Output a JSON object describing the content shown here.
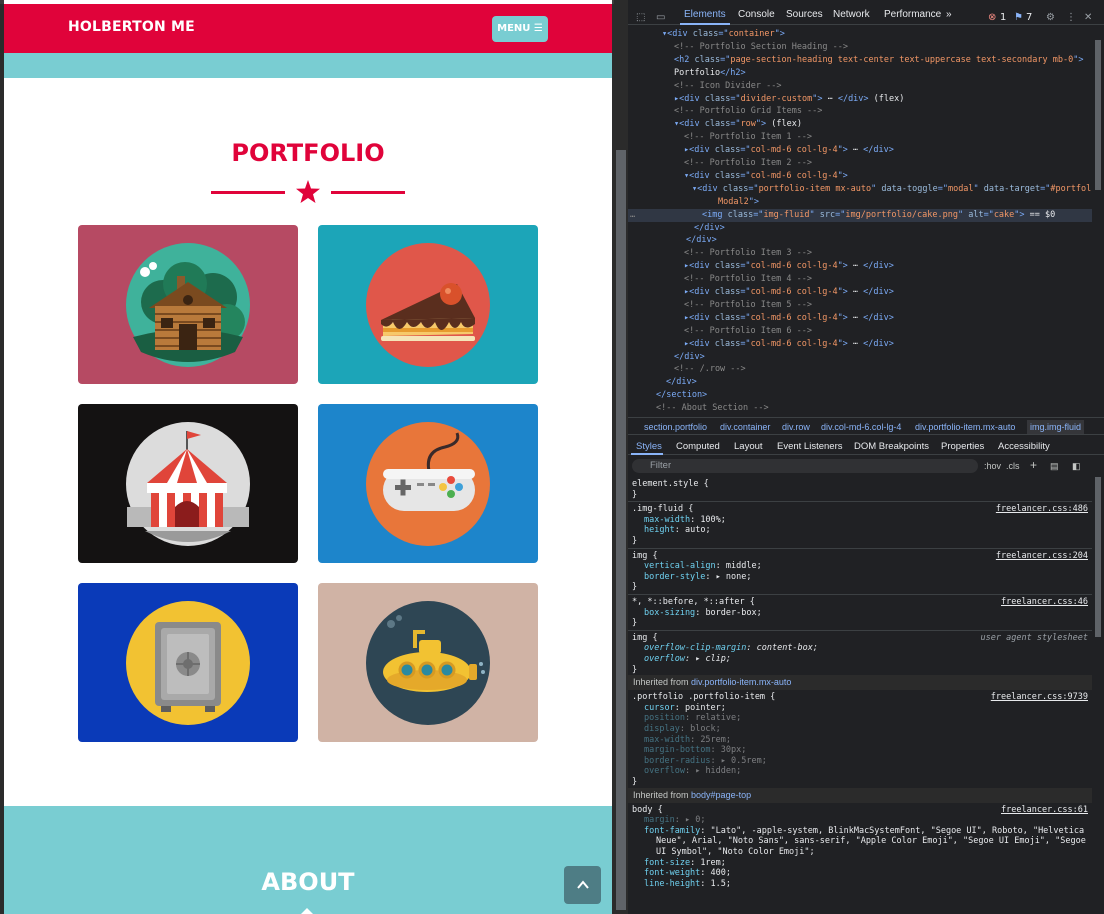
{
  "site": {
    "brand": "HOLBERTON ME",
    "menu_label": "MENU ☰",
    "portfolio_heading": "PORTFOLIO",
    "about_heading": "ABOUT",
    "portfolio_items": [
      {
        "alt": "cabin",
        "bg": "#b64a63"
      },
      {
        "alt": "cake",
        "bg": "#1ca5b8"
      },
      {
        "alt": "circus",
        "bg": "#141212"
      },
      {
        "alt": "game",
        "bg": "#1d85cb"
      },
      {
        "alt": "safe",
        "bg": "#0a3ab8"
      },
      {
        "alt": "submarine",
        "bg": "#d0b3a5"
      }
    ],
    "scroll_top_icon": "chevron-up-icon"
  },
  "devtools": {
    "tabs": [
      "Elements",
      "Console",
      "Sources",
      "Network",
      "Performance",
      "»"
    ],
    "errors": "1",
    "messages": "7",
    "breadcrumbs": [
      "section.portfolio",
      "div.container",
      "div.row",
      "div.col-md-6.col-lg-4",
      "div.portfolio-item.mx-auto",
      "img.img-fluid"
    ],
    "style_tabs": [
      "Styles",
      "Computed",
      "Layout",
      "Event Listeners",
      "DOM Breakpoints",
      "Properties",
      "Accessibility"
    ],
    "filter_placeholder": "Filter",
    "filter_tools": [
      ":hov",
      ".cls"
    ],
    "dom_lines": [
      {
        "segs": [
          [
            "tg",
            "▾<div "
          ],
          [
            "at",
            "class"
          ],
          [
            "tg",
            "=\""
          ],
          [
            "av",
            "container"
          ],
          [
            "tg",
            "\">"
          ]
        ]
      },
      {
        "segs": [
          [
            "cm",
            "<!-- Portfolio Section Heading -->"
          ]
        ]
      },
      {
        "segs": [
          [
            "tg",
            "<h2 "
          ],
          [
            "at",
            "class"
          ],
          [
            "tg",
            "=\""
          ],
          [
            "av",
            "page-section-heading text-center text-uppercase text-secondary mb-0"
          ],
          [
            "tg",
            "\">"
          ]
        ]
      },
      {
        "segs": [
          [
            "txt",
            "Portfolio"
          ],
          [
            "tg",
            "</h2>"
          ]
        ]
      },
      {
        "segs": [
          [
            "cm",
            "<!-- Icon Divider -->"
          ]
        ]
      },
      {
        "segs": [
          [
            "tg",
            "▸<div "
          ],
          [
            "at",
            "class"
          ],
          [
            "tg",
            "=\""
          ],
          [
            "av",
            "divider-custom"
          ],
          [
            "tg",
            "\">"
          ],
          [
            "txt",
            " ⋯ "
          ],
          [
            "tg",
            "</div>"
          ],
          [
            "txt",
            " (flex)"
          ]
        ]
      },
      {
        "segs": [
          [
            "cm",
            "<!-- Portfolio Grid Items -->"
          ]
        ]
      },
      {
        "segs": [
          [
            "tg",
            "▾<div "
          ],
          [
            "at",
            "class"
          ],
          [
            "tg",
            "=\""
          ],
          [
            "av",
            "row"
          ],
          [
            "tg",
            "\">"
          ],
          [
            "txt",
            " (flex)"
          ]
        ]
      },
      {
        "segs": [
          [
            "cm",
            "<!-- Portfolio Item 1 -->"
          ]
        ]
      },
      {
        "segs": [
          [
            "tg",
            "▸<div "
          ],
          [
            "at",
            "class"
          ],
          [
            "tg",
            "=\""
          ],
          [
            "av",
            "col-md-6 col-lg-4"
          ],
          [
            "tg",
            "\">"
          ],
          [
            "txt",
            " ⋯ "
          ],
          [
            "tg",
            "</div>"
          ]
        ]
      },
      {
        "segs": [
          [
            "cm",
            "<!-- Portfolio Item 2 -->"
          ]
        ]
      },
      {
        "segs": [
          [
            "tg",
            "▾<div "
          ],
          [
            "at",
            "class"
          ],
          [
            "tg",
            "=\""
          ],
          [
            "av",
            "col-md-6 col-lg-4"
          ],
          [
            "tg",
            "\">"
          ]
        ]
      },
      {
        "segs": [
          [
            "tg",
            "▾<div "
          ],
          [
            "at",
            "class"
          ],
          [
            "tg",
            "=\""
          ],
          [
            "av",
            "portfolio-item mx-auto"
          ],
          [
            "tg",
            "\" "
          ],
          [
            "at",
            "data-toggle"
          ],
          [
            "tg",
            "=\""
          ],
          [
            "av",
            "modal"
          ],
          [
            "tg",
            "\" "
          ],
          [
            "at",
            "data-target"
          ],
          [
            "tg",
            "=\""
          ],
          [
            "av",
            "#portfolio"
          ]
        ]
      },
      {
        "segs": [
          [
            "av",
            "Modal2"
          ],
          [
            "tg",
            "\">"
          ]
        ]
      },
      {
        "segs": [
          [
            "tg",
            "<img "
          ],
          [
            "at",
            "class"
          ],
          [
            "tg",
            "=\""
          ],
          [
            "av",
            "img-fluid"
          ],
          [
            "tg",
            "\" "
          ],
          [
            "at",
            "src"
          ],
          [
            "tg",
            "=\""
          ],
          [
            "av",
            "img/portfolio/cake.png"
          ],
          [
            "tg",
            "\" "
          ],
          [
            "at",
            "alt"
          ],
          [
            "tg",
            "=\""
          ],
          [
            "av",
            "cake"
          ],
          [
            "tg",
            "\">"
          ],
          [
            "txt",
            " == $0"
          ]
        ]
      },
      {
        "segs": [
          [
            "tg",
            "</div>"
          ]
        ]
      },
      {
        "segs": [
          [
            "tg",
            "</div>"
          ]
        ]
      },
      {
        "segs": [
          [
            "cm",
            "<!-- Portfolio Item 3 -->"
          ]
        ]
      },
      {
        "segs": [
          [
            "tg",
            "▸<div "
          ],
          [
            "at",
            "class"
          ],
          [
            "tg",
            "=\""
          ],
          [
            "av",
            "col-md-6 col-lg-4"
          ],
          [
            "tg",
            "\">"
          ],
          [
            "txt",
            " ⋯ "
          ],
          [
            "tg",
            "</div>"
          ]
        ]
      },
      {
        "segs": [
          [
            "cm",
            "<!-- Portfolio Item 4 -->"
          ]
        ]
      },
      {
        "segs": [
          [
            "tg",
            "▸<div "
          ],
          [
            "at",
            "class"
          ],
          [
            "tg",
            "=\""
          ],
          [
            "av",
            "col-md-6 col-lg-4"
          ],
          [
            "tg",
            "\">"
          ],
          [
            "txt",
            " ⋯ "
          ],
          [
            "tg",
            "</div>"
          ]
        ]
      },
      {
        "segs": [
          [
            "cm",
            "<!-- Portfolio Item 5 -->"
          ]
        ]
      },
      {
        "segs": [
          [
            "tg",
            "▸<div "
          ],
          [
            "at",
            "class"
          ],
          [
            "tg",
            "=\""
          ],
          [
            "av",
            "col-md-6 col-lg-4"
          ],
          [
            "tg",
            "\">"
          ],
          [
            "txt",
            " ⋯ "
          ],
          [
            "tg",
            "</div>"
          ]
        ]
      },
      {
        "segs": [
          [
            "cm",
            "<!-- Portfolio Item 6 -->"
          ]
        ]
      },
      {
        "segs": [
          [
            "tg",
            "▸<div "
          ],
          [
            "at",
            "class"
          ],
          [
            "tg",
            "=\""
          ],
          [
            "av",
            "col-md-6 col-lg-4"
          ],
          [
            "tg",
            "\">"
          ],
          [
            "txt",
            " ⋯ "
          ],
          [
            "tg",
            "</div>"
          ]
        ]
      },
      {
        "segs": [
          [
            "tg",
            "</div>"
          ]
        ]
      },
      {
        "segs": [
          [
            "cm",
            "<!-- /.row -->"
          ]
        ]
      },
      {
        "segs": [
          [
            "tg",
            "</div>"
          ]
        ]
      },
      {
        "segs": [
          [
            "tg",
            "</section>"
          ]
        ]
      },
      {
        "segs": [
          [
            "cm",
            "<!-- About Section -->"
          ]
        ]
      }
    ],
    "rules": [
      {
        "kind": "line",
        "text": "element.style {"
      },
      {
        "kind": "line",
        "text": "}"
      },
      {
        "kind": "sep"
      },
      {
        "kind": "sel",
        "text": ".img-fluid {",
        "src": "freelancer.css:486"
      },
      {
        "kind": "prop",
        "name": "max-width",
        "value": "100%;"
      },
      {
        "kind": "prop",
        "name": "height",
        "value": "auto;"
      },
      {
        "kind": "line",
        "text": "}"
      },
      {
        "kind": "sep"
      },
      {
        "kind": "sel",
        "text": "img {",
        "src": "freelancer.css:204"
      },
      {
        "kind": "prop",
        "name": "vertical-align",
        "value": "middle;"
      },
      {
        "kind": "prop",
        "name": "border-style",
        "value": "▸ none;"
      },
      {
        "kind": "line",
        "text": "}"
      },
      {
        "kind": "sep"
      },
      {
        "kind": "sel",
        "text": "*, *::before, *::after {",
        "src": "freelancer.css:46"
      },
      {
        "kind": "prop",
        "name": "box-sizing",
        "value": "border-box;"
      },
      {
        "kind": "line",
        "text": "}"
      },
      {
        "kind": "sep"
      },
      {
        "kind": "sel",
        "text": "img {",
        "ua": "user agent stylesheet"
      },
      {
        "kind": "prop",
        "name": "overflow-clip-margin",
        "value": "content-box;",
        "italic": true
      },
      {
        "kind": "prop",
        "name": "overflow",
        "value": "▸ clip;",
        "italic": true
      },
      {
        "kind": "line",
        "text": "}"
      },
      {
        "kind": "inh",
        "text": "Inherited from ",
        "link": "div.portfolio-item.mx-auto"
      },
      {
        "kind": "sel",
        "text": ".portfolio .portfolio-item {",
        "src": "freelancer.css:9739"
      },
      {
        "kind": "prop",
        "name": "cursor",
        "value": "pointer;"
      },
      {
        "kind": "prop",
        "name": "position",
        "value": "relative;",
        "dim": true
      },
      {
        "kind": "prop",
        "name": "display",
        "value": "block;",
        "dim": true
      },
      {
        "kind": "prop",
        "name": "max-width",
        "value": "25rem;",
        "dim": true
      },
      {
        "kind": "prop",
        "name": "margin-bottom",
        "value": "30px;",
        "dim": true
      },
      {
        "kind": "prop",
        "name": "border-radius",
        "value": "▸ 0.5rem;",
        "dim": true
      },
      {
        "kind": "prop",
        "name": "overflow",
        "value": "▸ hidden;",
        "dim": true
      },
      {
        "kind": "line",
        "text": "}"
      },
      {
        "kind": "inh",
        "text": "Inherited from ",
        "link": "body#page-top"
      },
      {
        "kind": "sel",
        "text": "body {",
        "src": "freelancer.css:61"
      },
      {
        "kind": "prop",
        "name": "margin",
        "value": "▸ 0;",
        "dim": true
      },
      {
        "kind": "prop",
        "name": "font-family",
        "value": "\"Lato\", -apple-system, BlinkMacSystemFont, \"Segoe UI\", Roboto, \"Helvetica"
      },
      {
        "kind": "cont",
        "text": "Neue\", Arial, \"Noto Sans\", sans-serif, \"Apple Color Emoji\", \"Segoe UI Emoji\", \"Segoe"
      },
      {
        "kind": "cont",
        "text": "UI Symbol\", \"Noto Color Emoji\";"
      },
      {
        "kind": "prop",
        "name": "font-size",
        "value": "1rem;"
      },
      {
        "kind": "prop",
        "name": "font-weight",
        "value": "400;"
      },
      {
        "kind": "prop",
        "name": "line-height",
        "value": "1.5;"
      }
    ]
  }
}
